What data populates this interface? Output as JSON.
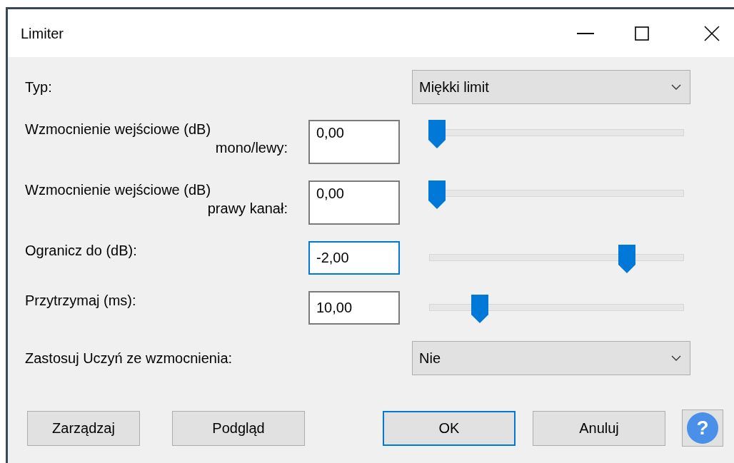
{
  "window": {
    "title": "Limiter"
  },
  "rows": [
    {
      "kind": "dropdown",
      "label": "Typ:",
      "value": "Miękki limit"
    },
    {
      "kind": "slider",
      "label": "Wzmocnienie wejściowe (dB)",
      "label_2": "mono/lewy:",
      "value": "0,00",
      "focused": false,
      "level": 0
    },
    {
      "kind": "slider",
      "label": "Wzmocnienie wejściowe (dB)",
      "label_2": "prawy kanał:",
      "value": "0,00",
      "focused": false,
      "level": 0
    },
    {
      "kind": "slider",
      "label": "Ogranicz do (dB):",
      "value": "-2,00",
      "focused": true,
      "level": 0.8
    },
    {
      "kind": "slider",
      "label": "Przytrzymaj (ms):",
      "value": "10,00",
      "focused": false,
      "level": 0.18
    },
    {
      "kind": "dropdown",
      "label": "Zastosuj Uczyń ze wzmocnienia:",
      "value": "Nie"
    }
  ],
  "buttons": [
    {
      "label": "Zarządzaj",
      "default": false
    },
    {
      "label": "Podgląd",
      "default": false
    },
    {
      "label": "OK",
      "default": true
    },
    {
      "label": "Anuluj",
      "default": false
    }
  ],
  "help_button": {
    "label": "?"
  }
}
